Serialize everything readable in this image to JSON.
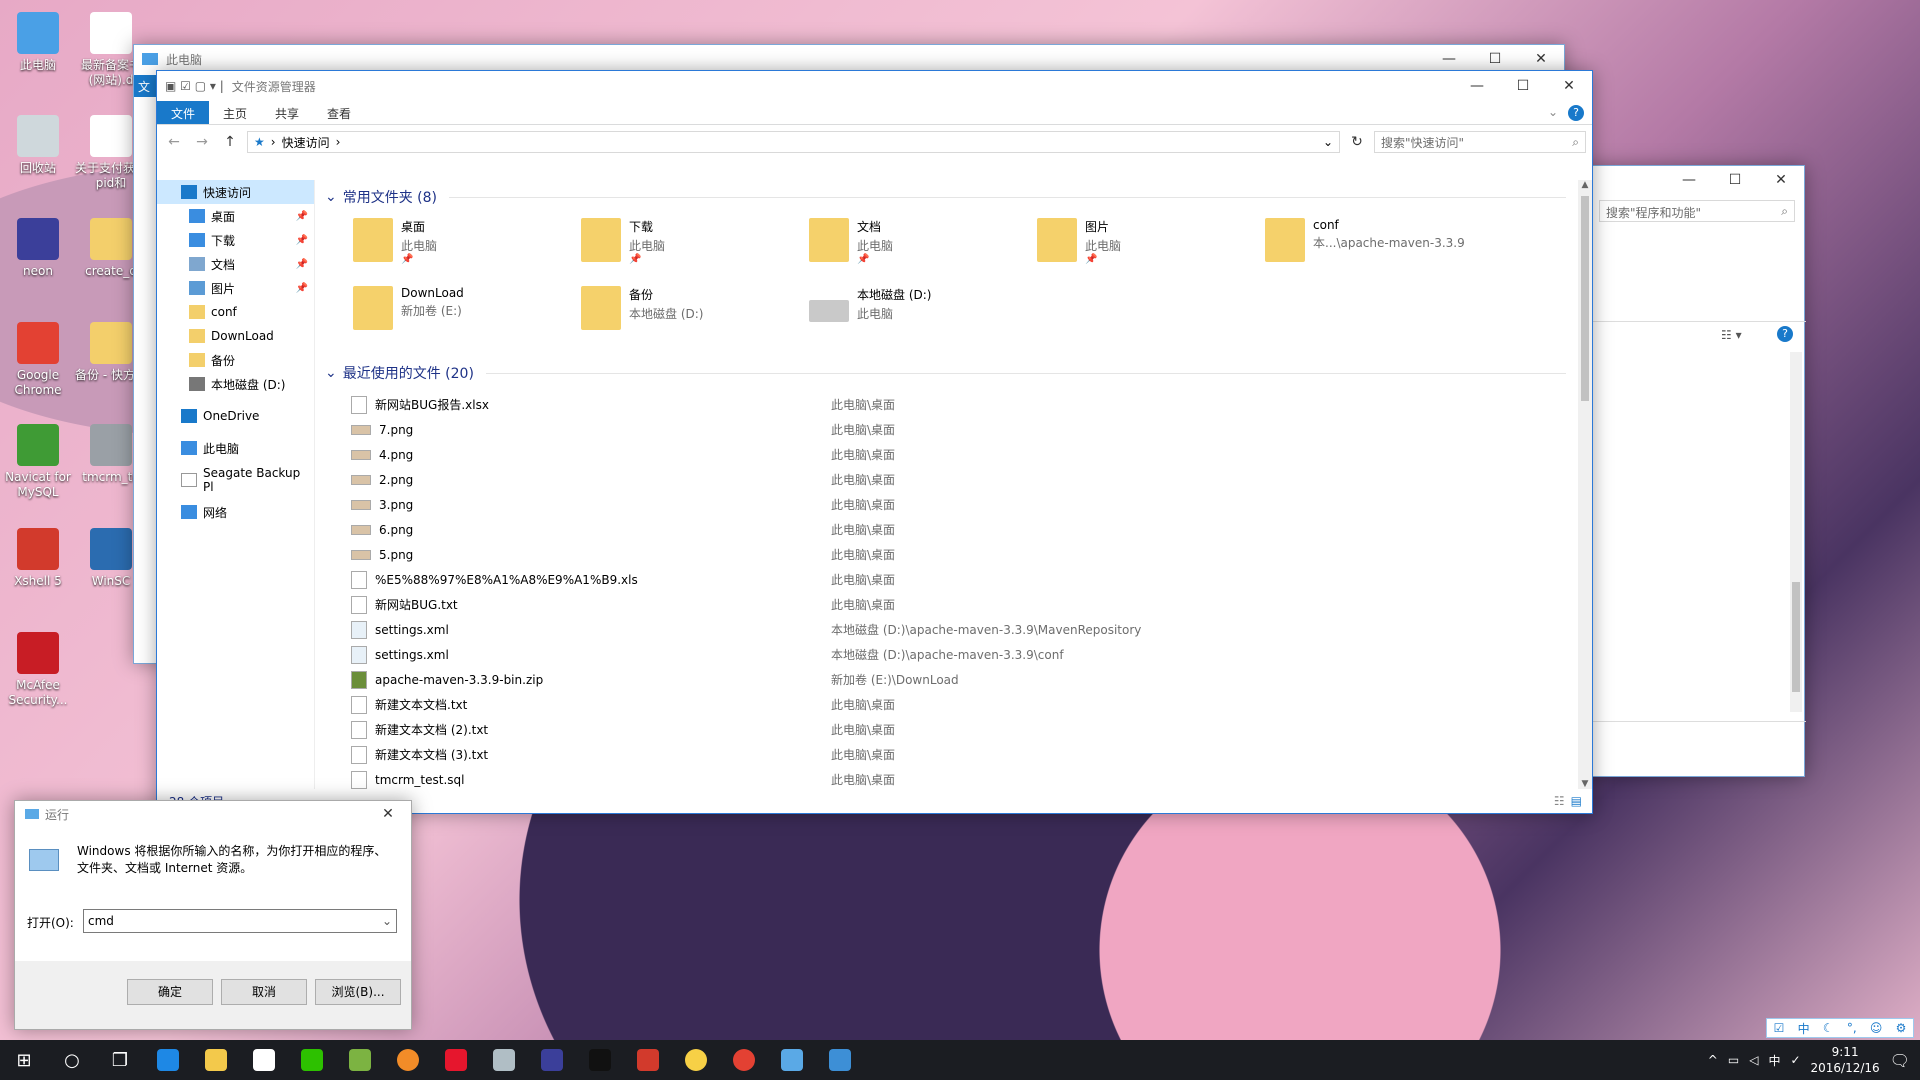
{
  "desktop": {
    "icons": [
      {
        "label": "此电脑",
        "color": "#4aa0e6"
      },
      {
        "label": "回收站",
        "color": "#cfd8dc"
      },
      {
        "label": "neon",
        "color": "#3b3f9a"
      },
      {
        "label": "Google Chrome",
        "color": "#e34133"
      },
      {
        "label": "Navicat for MySQL",
        "color": "#3f9b35"
      },
      {
        "label": "Xshell 5",
        "color": "#d23a2c"
      },
      {
        "label": "McAfee Security...",
        "color": "#c81d25"
      },
      {
        "label": "最新备案书(网站).d",
        "color": "#ffffff"
      },
      {
        "label": "关于支付获取pid和",
        "color": "#ffffff"
      },
      {
        "label": "create_d",
        "color": "#f3cf6b"
      },
      {
        "label": "备份 - 快方式",
        "color": "#f3cf6b"
      },
      {
        "label": "tmcrm_te",
        "color": "#9aa0a6"
      },
      {
        "label": "WinSC",
        "color": "#2b6cb0"
      }
    ]
  },
  "back_window": {
    "title": "此电脑",
    "ribbon_tab": "文"
  },
  "explorer": {
    "title": "文件资源管理器",
    "tabs": [
      "文件",
      "主页",
      "共享",
      "查看"
    ],
    "address": "快速访问",
    "search_placeholder": "搜索\"快速访问\"",
    "nav": [
      {
        "label": "快速访问",
        "sel": true,
        "sub": false,
        "pin": false
      },
      {
        "label": "桌面",
        "sel": false,
        "sub": true,
        "pin": true
      },
      {
        "label": "下载",
        "sel": false,
        "sub": true,
        "pin": true
      },
      {
        "label": "文档",
        "sel": false,
        "sub": true,
        "pin": true
      },
      {
        "label": "图片",
        "sel": false,
        "sub": true,
        "pin": true
      },
      {
        "label": "conf",
        "sel": false,
        "sub": true,
        "pin": false
      },
      {
        "label": "DownLoad",
        "sel": false,
        "sub": true,
        "pin": false
      },
      {
        "label": "备份",
        "sel": false,
        "sub": true,
        "pin": false
      },
      {
        "label": "本地磁盘 (D:)",
        "sel": false,
        "sub": true,
        "pin": false
      },
      {
        "label": "OneDrive",
        "sel": false,
        "sub": false,
        "pin": false
      },
      {
        "label": "此电脑",
        "sel": false,
        "sub": false,
        "pin": false
      },
      {
        "label": "Seagate Backup Pl",
        "sel": false,
        "sub": false,
        "pin": false
      },
      {
        "label": "网络",
        "sel": false,
        "sub": false,
        "pin": false
      }
    ],
    "frequent_header": "常用文件夹 (8)",
    "frequent": [
      {
        "name": "桌面",
        "loc": "此电脑",
        "pinned": true
      },
      {
        "name": "下载",
        "loc": "此电脑",
        "pinned": true
      },
      {
        "name": "文档",
        "loc": "此电脑",
        "pinned": true
      },
      {
        "name": "图片",
        "loc": "此电脑",
        "pinned": true
      },
      {
        "name": "conf",
        "loc": "本...\\apache-maven-3.3.9",
        "pinned": false
      },
      {
        "name": "DownLoad",
        "loc": "新加卷 (E:)",
        "pinned": false
      },
      {
        "name": "备份",
        "loc": "本地磁盘 (D:)",
        "pinned": false
      },
      {
        "name": "本地磁盘 (D:)",
        "loc": "此电脑",
        "pinned": false
      }
    ],
    "recent_header": "最近使用的文件 (20)",
    "recent": [
      {
        "name": "新网站BUG报告.xlsx",
        "path": "此电脑\\桌面"
      },
      {
        "name": "7.png",
        "path": "此电脑\\桌面"
      },
      {
        "name": "4.png",
        "path": "此电脑\\桌面"
      },
      {
        "name": "2.png",
        "path": "此电脑\\桌面"
      },
      {
        "name": "3.png",
        "path": "此电脑\\桌面"
      },
      {
        "name": "6.png",
        "path": "此电脑\\桌面"
      },
      {
        "name": "5.png",
        "path": "此电脑\\桌面"
      },
      {
        "name": "%E5%88%97%E8%A1%A8%E9%A1%B9.xls",
        "path": "此电脑\\桌面"
      },
      {
        "name": "新网站BUG.txt",
        "path": "此电脑\\桌面"
      },
      {
        "name": "settings.xml",
        "path": "本地磁盘 (D:)\\apache-maven-3.3.9\\MavenRepository"
      },
      {
        "name": "settings.xml",
        "path": "本地磁盘 (D:)\\apache-maven-3.3.9\\conf"
      },
      {
        "name": "apache-maven-3.3.9-bin.zip",
        "path": "新加卷 (E:)\\DownLoad"
      },
      {
        "name": "新建文本文档.txt",
        "path": "此电脑\\桌面"
      },
      {
        "name": "新建文本文档 (2).txt",
        "path": "此电脑\\桌面"
      },
      {
        "name": "新建文本文档 (3).txt",
        "path": "此电脑\\桌面"
      },
      {
        "name": "tmcrm_test.sql",
        "path": "此电脑\\桌面"
      }
    ],
    "status": "28 个项目"
  },
  "programs_window": {
    "search_placeholder": "搜索\"程序和功能\""
  },
  "run_dialog": {
    "title": "运行",
    "description": "Windows 将根据你所输入的名称，为你打开相应的程序、文件夹、文档或 Internet 资源。",
    "open_label": "打开(O):",
    "input_value": "cmd",
    "ok": "确定",
    "cancel": "取消",
    "browse": "浏览(B)..."
  },
  "taskbar": {
    "icons": [
      {
        "name": "edge",
        "color": "#1e88e5"
      },
      {
        "name": "explorer",
        "color": "#f3c94b"
      },
      {
        "name": "store",
        "color": "#ffffff"
      },
      {
        "name": "wechat",
        "color": "#2dc100"
      },
      {
        "name": "notepad-plus",
        "color": "#7cb342"
      },
      {
        "name": "app-orange",
        "color": "#f28c28"
      },
      {
        "name": "weibo",
        "color": "#e6162d"
      },
      {
        "name": "app-gray",
        "color": "#b0bec5"
      },
      {
        "name": "neon",
        "color": "#3b3f9a"
      },
      {
        "name": "qq",
        "color": "#111111"
      },
      {
        "name": "xshell",
        "color": "#d23a2c"
      },
      {
        "name": "app-yellow",
        "color": "#f7d046"
      },
      {
        "name": "chrome",
        "color": "#e34133"
      },
      {
        "name": "app-blue",
        "color": "#5aa9e6"
      },
      {
        "name": "app-blue2",
        "color": "#3d8fd6"
      }
    ],
    "ime": "中",
    "time": "9:11",
    "date": "2016/12/16"
  }
}
